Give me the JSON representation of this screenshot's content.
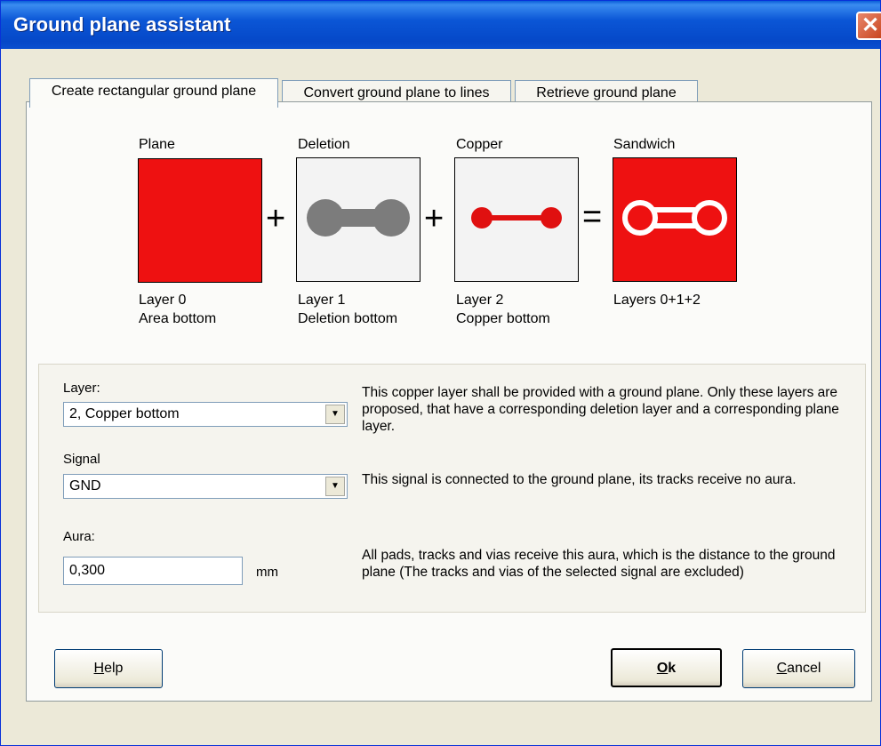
{
  "window": {
    "title": "Ground plane assistant",
    "close_glyph": "✕"
  },
  "tabs": [
    {
      "label": "Create rectangular ground plane",
      "active": true
    },
    {
      "label": "Convert ground plane to lines",
      "active": false
    },
    {
      "label": "Retrieve ground plane",
      "active": false
    }
  ],
  "diagram": {
    "operators": [
      "+",
      "+",
      "="
    ],
    "panels": [
      {
        "title": "Plane",
        "line1": "Layer 0",
        "line2": "Area bottom",
        "fill": "#ee1111"
      },
      {
        "title": "Deletion",
        "line1": "Layer 1",
        "line2": "Deletion bottom",
        "fill": "#f3f3f3",
        "shape_color": "#7c7c7c"
      },
      {
        "title": "Copper",
        "line1": "Layer 2",
        "line2": "Copper bottom",
        "fill": "#f3f3f3",
        "shape_color": "#e01010"
      },
      {
        "title": "Sandwich",
        "line1": "Layers 0+1+2",
        "line2": "",
        "fill": "#ee1111",
        "shape_color": "#ffffff"
      }
    ]
  },
  "form": {
    "layer": {
      "label": "Layer:",
      "value": "2, Copper bottom",
      "description": "This copper layer shall be provided with a ground plane. Only these layers are proposed, that have a corresponding deletion layer and a corresponding plane layer."
    },
    "signal": {
      "label": "Signal",
      "value": "GND",
      "description": "This signal is connected to the ground plane, its tracks receive no aura."
    },
    "aura": {
      "label": "Aura:",
      "value": "0,300",
      "unit": "mm",
      "description": "All pads, tracks and vias receive this aura, which is the distance to the ground plane (The tracks and vias of the selected signal are excluded)"
    }
  },
  "buttons": {
    "help": {
      "mnemonic": "H",
      "rest": "elp"
    },
    "ok": {
      "mnemonic": "O",
      "rest": "k"
    },
    "cancel": {
      "mnemonic": "C",
      "rest": "ancel"
    }
  }
}
